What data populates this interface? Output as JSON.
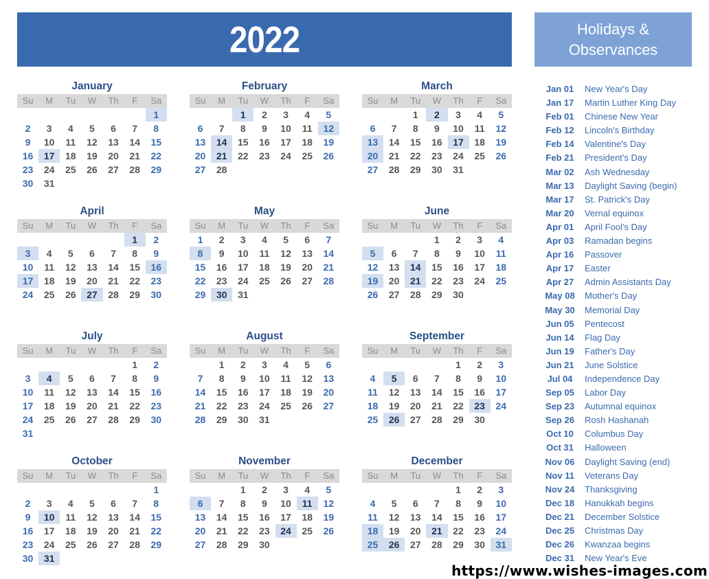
{
  "header": {
    "year": "2022",
    "holidays_title_line1": "Holidays &",
    "holidays_title_line2": "Observances"
  },
  "colors": {
    "banner": "#3a6aae",
    "holiday_banner": "#7ea2d6",
    "highlight": "#d3dfef",
    "weekend_text": "#3a6aae",
    "weekday_text": "#555555",
    "dow_header_bg": "#d9d9d9"
  },
  "weekdays": [
    "Su",
    "M",
    "Tu",
    "W",
    "Th",
    "F",
    "Sa"
  ],
  "months": [
    {
      "name": "January",
      "start": 6,
      "days": 31,
      "highlights": [
        1,
        17
      ]
    },
    {
      "name": "February",
      "start": 2,
      "days": 28,
      "highlights": [
        1,
        12,
        14,
        21
      ]
    },
    {
      "name": "March",
      "start": 2,
      "days": 31,
      "highlights": [
        2,
        13,
        17,
        20
      ]
    },
    {
      "name": "April",
      "start": 5,
      "days": 30,
      "highlights": [
        1,
        3,
        16,
        17,
        27
      ]
    },
    {
      "name": "May",
      "start": 0,
      "days": 31,
      "highlights": [
        8,
        30
      ]
    },
    {
      "name": "June",
      "start": 3,
      "days": 30,
      "highlights": [
        5,
        14,
        19,
        21
      ]
    },
    {
      "name": "July",
      "start": 5,
      "days": 31,
      "highlights": [
        4
      ]
    },
    {
      "name": "August",
      "start": 1,
      "days": 31,
      "highlights": []
    },
    {
      "name": "September",
      "start": 4,
      "days": 30,
      "highlights": [
        5,
        23,
        26
      ]
    },
    {
      "name": "October",
      "start": 6,
      "days": 31,
      "highlights": [
        10,
        31
      ]
    },
    {
      "name": "November",
      "start": 2,
      "days": 30,
      "highlights": [
        6,
        11,
        24
      ]
    },
    {
      "name": "December",
      "start": 4,
      "days": 31,
      "highlights": [
        18,
        21,
        25,
        26,
        31
      ]
    }
  ],
  "holidays": [
    {
      "date": "Jan 01",
      "name": "New Year's Day"
    },
    {
      "date": "Jan 17",
      "name": "Martin Luther King Day"
    },
    {
      "date": "Feb 01",
      "name": "Chinese New Year"
    },
    {
      "date": "Feb 12",
      "name": "Lincoln's Birthday"
    },
    {
      "date": "Feb 14",
      "name": "Valentine's Day"
    },
    {
      "date": "Feb 21",
      "name": "President's Day"
    },
    {
      "date": "Mar 02",
      "name": "Ash Wednesday"
    },
    {
      "date": "Mar 13",
      "name": "Daylight Saving (begin)"
    },
    {
      "date": "Mar 17",
      "name": "St. Patrick's Day"
    },
    {
      "date": "Mar 20",
      "name": "Vernal equinox"
    },
    {
      "date": "Apr 01",
      "name": "April Fool's Day"
    },
    {
      "date": "Apr 03",
      "name": "Ramadan begins"
    },
    {
      "date": "Apr 16",
      "name": "Passover"
    },
    {
      "date": "Apr 17",
      "name": "Easter"
    },
    {
      "date": "Apr 27",
      "name": "Admin Assistants Day"
    },
    {
      "date": "May 08",
      "name": "Mother's Day"
    },
    {
      "date": "May 30",
      "name": "Memorial Day"
    },
    {
      "date": "Jun 05",
      "name": "Pentecost"
    },
    {
      "date": "Jun 14",
      "name": "Flag Day"
    },
    {
      "date": "Jun 19",
      "name": "Father's Day"
    },
    {
      "date": "Jun 21",
      "name": "June Solstice"
    },
    {
      "date": "Jul 04",
      "name": "Independence Day"
    },
    {
      "date": "Sep 05",
      "name": "Labor Day"
    },
    {
      "date": "Sep 23",
      "name": "Autumnal equinox"
    },
    {
      "date": "Sep 26",
      "name": "Rosh Hashanah"
    },
    {
      "date": "Oct 10",
      "name": "Columbus Day"
    },
    {
      "date": "Oct 31",
      "name": "Halloween"
    },
    {
      "date": "Nov 06",
      "name": "Daylight Saving (end)"
    },
    {
      "date": "Nov 11",
      "name": "Veterans Day"
    },
    {
      "date": "Nov 24",
      "name": "Thanksgiving"
    },
    {
      "date": "Dec 18",
      "name": "Hanukkah begins"
    },
    {
      "date": "Dec 21",
      "name": "December Solstice"
    },
    {
      "date": "Dec 25",
      "name": "Christmas Day"
    },
    {
      "date": "Dec 26",
      "name": "Kwanzaa begins"
    },
    {
      "date": "Dec 31",
      "name": "New Year's Eve"
    }
  ],
  "watermark": "https://www.wishes-images.com"
}
